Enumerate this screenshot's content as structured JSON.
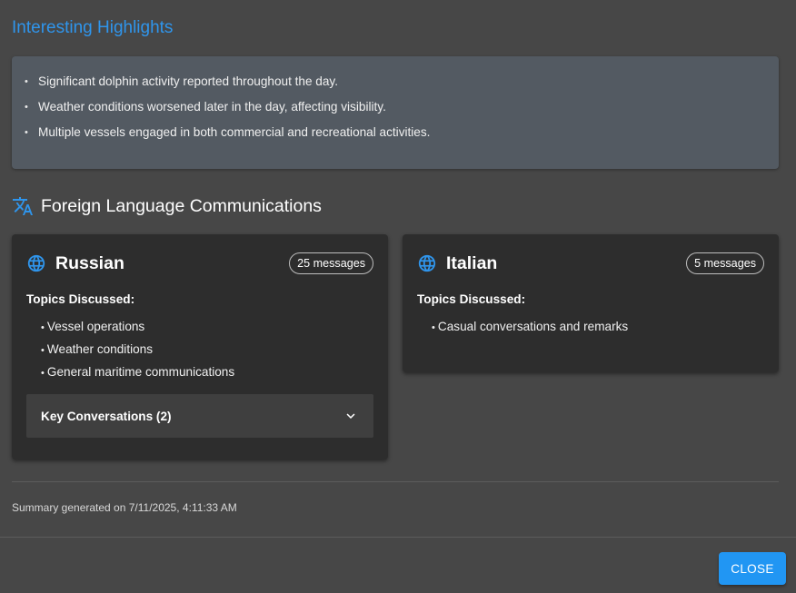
{
  "highlights": {
    "title": "Interesting Highlights",
    "items": [
      "Significant dolphin activity reported throughout the day.",
      "Weather conditions worsened later in the day, affecting visibility.",
      "Multiple vessels engaged in both commercial and recreational activities."
    ]
  },
  "foreign": {
    "title": "Foreign Language Communications",
    "icon": "translate-icon",
    "languages": [
      {
        "name": "Russian",
        "icon": "globe-icon",
        "badge": "25 messages",
        "topics_label": "Topics Discussed:",
        "topics": [
          "Vessel operations",
          "Weather conditions",
          "General maritime communications"
        ],
        "key_conversations_label": "Key Conversations (2)"
      },
      {
        "name": "Italian",
        "icon": "globe-icon",
        "badge": "5 messages",
        "topics_label": "Topics Discussed:",
        "topics": [
          "Casual conversations and remarks"
        ]
      }
    ]
  },
  "summary": {
    "generated": "Summary generated on 7/11/2025, 4:11:33 AM"
  },
  "footer": {
    "close_label": "CLOSE"
  },
  "colors": {
    "background": "#474747",
    "accent": "#2f95ec",
    "card": "#2d2d2d",
    "highlight_box": "#535a62",
    "button": "#2196f3"
  }
}
